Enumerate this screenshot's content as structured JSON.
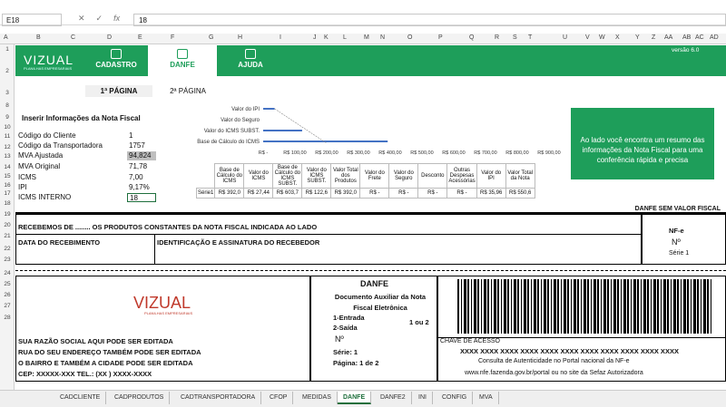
{
  "formula_bar": {
    "name_box": "E18",
    "formula": "18",
    "icons": [
      "cancel-icon",
      "confirm-icon",
      "function-icon"
    ]
  },
  "columns": [
    "A",
    "B",
    "C",
    "D",
    "E",
    "F",
    "G",
    "H",
    "I",
    "J",
    "K",
    "L",
    "M",
    "N",
    "O",
    "P",
    "Q",
    "R",
    "S",
    "T",
    "U",
    "V",
    "W",
    "X",
    "Y",
    "Z",
    "AA",
    "AB",
    "AC",
    "AD"
  ],
  "rows": [
    "1",
    "2",
    "3",
    "8",
    "9",
    "10",
    "11",
    "12",
    "13",
    "14",
    "15",
    "16",
    "17",
    "18",
    "19",
    "20",
    "21",
    "22",
    "23",
    "24",
    "25",
    "26",
    "27",
    "28"
  ],
  "ribbon": {
    "logo": "VIZUAL",
    "logo_sub": "PLANILHAS EMPRESARIAIS",
    "tabs": [
      {
        "label": "CADASTRO"
      },
      {
        "label": "DANFE"
      },
      {
        "label": "AJUDA"
      }
    ],
    "version": "versão 6.0"
  },
  "subtabs": [
    "1ª PÁGINA",
    "2ª PÁGINA"
  ],
  "info": {
    "title": "Inserir Informações da Nota Fiscal",
    "rows": [
      {
        "label": "Código do Cliente",
        "value": "1"
      },
      {
        "label": "Código da Transportadora",
        "value": "1757"
      },
      {
        "label": "MVA Ajustada",
        "value": "94,824"
      },
      {
        "label": "MVA Original",
        "value": "71,78"
      },
      {
        "label": "ICMS",
        "value": "7,00"
      },
      {
        "label": "IPI",
        "value": "9,17%"
      },
      {
        "label": "ICMS INTERNO",
        "value": "18"
      }
    ]
  },
  "side_note": "Ao lado você encontra um resumo das informações da Nota Fiscal para uma conferência rápida e precisa",
  "chart_data": {
    "type": "bar",
    "orientation": "horizontal",
    "categories": [
      "Valor do IPI",
      "Valor do Seguro",
      "Valor do ICMS SUBST.",
      "Base de Cálculo do ICMS"
    ],
    "values": [
      35.96,
      0,
      122.6,
      392.0
    ],
    "xlim": [
      0,
      900
    ],
    "xticks": [
      "R$ -",
      "R$ 100,00",
      "R$ 200,00",
      "R$ 300,00",
      "R$ 400,00",
      "R$ 500,00",
      "R$ 600,00",
      "R$ 700,00",
      "R$ 800,00",
      "R$ 900,00"
    ]
  },
  "summary": {
    "headers": [
      "Base de Cálculo do ICMS",
      "Valor do ICMS",
      "Base de Cálculo do ICMS SUBST.",
      "Valor do ICMS SUBST.",
      "Valor Total dos Produtos",
      "Valor do Frete",
      "Valor do Seguro",
      "Desconto",
      "Outras Despesas Acessórias",
      "Valor do IPI",
      "Valor Total da Nota"
    ],
    "row_label": "Série1",
    "values": [
      "R$ 392,0",
      "R$ 27,44",
      "R$ 603,7",
      "R$ 122,6",
      "R$ 392,0",
      "R$ -",
      "R$ -",
      "R$ -",
      "R$ -",
      "R$ 35,96",
      "R$ 550,6"
    ]
  },
  "danfe": {
    "header_right": "DANFE SEM VALOR FISCAL",
    "received": "RECEBEMOS DE ........ OS PRODUTOS CONSTANTES DA NOTA FISCAL INDICADA AO LADO",
    "date_label": "DATA DO RECEBIMENTO",
    "sign_label": "IDENTIFICAÇÃO E ASSINATURA DO RECEBEDOR",
    "nfe": "NF-e",
    "num_symbol": "Nº",
    "serie": "Série 1",
    "company_logo": "VIZUAL",
    "company_logo_sub": "PLANILHAS EMPRESARIAIS",
    "company_lines": [
      "SUA RAZÃO SOCIAL AQUI PODE SER EDITADA",
      "RUA DO SEU ENDEREÇO TAMBÉM PODE SER EDITADA",
      "O BAIRRO E TAMBÉM A CIDADE PODE SER EDITADA",
      "CEP: XXXXX-XXX TEL.: (XX ) XXXX-XXXX"
    ],
    "title": "DANFE",
    "subtitle": "Documento Auxiliar da Nota Fiscal Eletrônica",
    "entrada": "1-Entrada",
    "saida": "2-Saída",
    "one_or_two": "1 ou 2",
    "serie2": "Série: 1",
    "pagina": "Página:  1 de 2",
    "chave_label": "CHAVE DE ACESSO",
    "chave": "XXXX XXXX XXXX XXXX XXXX XXXX XXXX XXXX XXXX XXXX XXXX",
    "consulta": "Consulta de Autenticidade no Portal nacional da NF-e",
    "site": "www.nfe.fazenda.gov.br/portal ou no site da Sefaz Autorizadora"
  },
  "sheet_tabs": [
    "CADCLIENTE",
    "CADPRODUTOS",
    "CADTRANSPORTADORA",
    "CFOP",
    "MEDIDAS",
    "DANFE",
    "DANFE2",
    "INI",
    "CONFIG",
    "MVA"
  ],
  "active_sheet": "DANFE"
}
